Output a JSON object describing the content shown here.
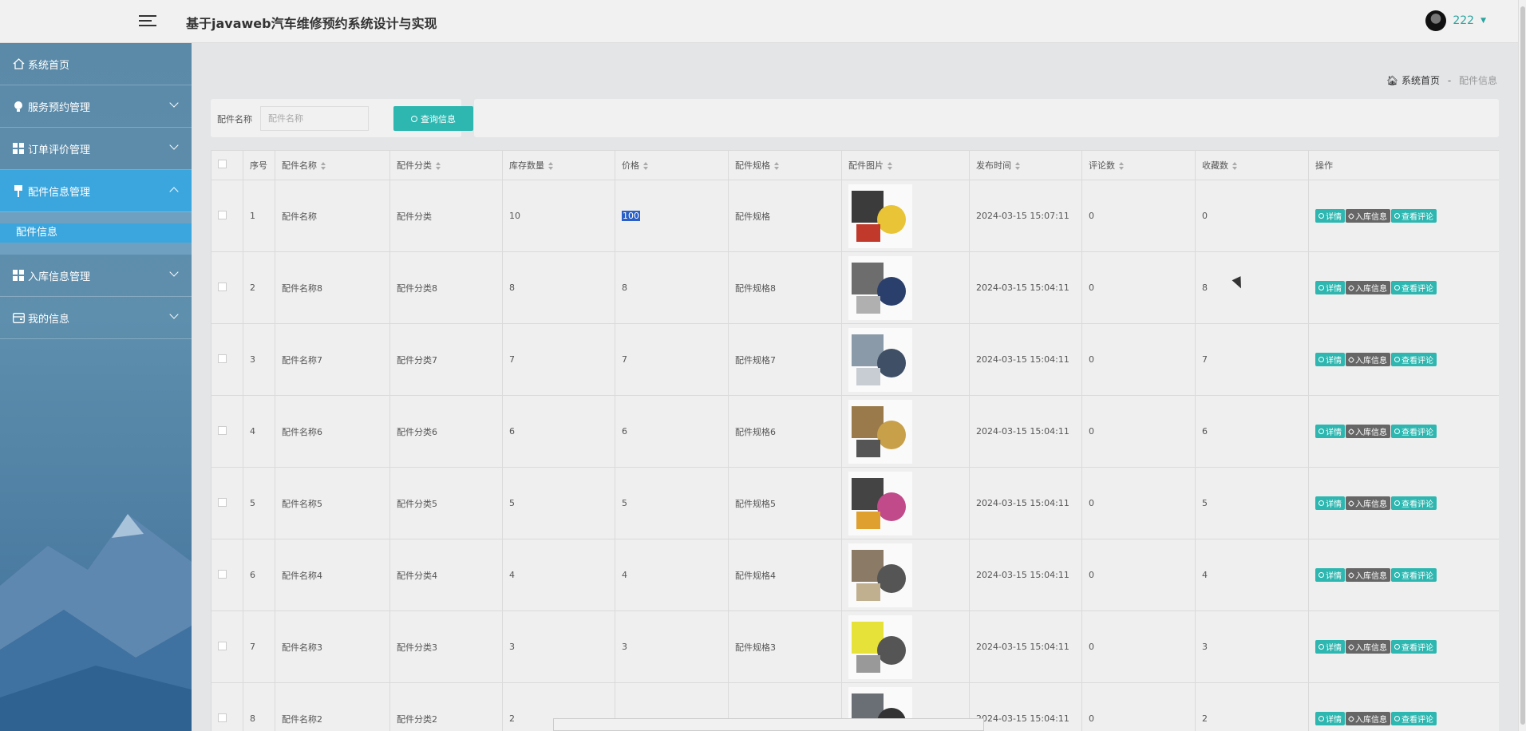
{
  "header": {
    "title": "基于javaweb汽车维修预约系统设计与实现",
    "username": "222"
  },
  "sidebar": {
    "items": [
      {
        "label": "系统首页",
        "icon": "home-icon"
      },
      {
        "label": "服务预约管理",
        "icon": "bulb-icon"
      },
      {
        "label": "订单评价管理",
        "icon": "grid-icon"
      },
      {
        "label": "配件信息管理",
        "icon": "pin-icon"
      },
      {
        "label": "入库信息管理",
        "icon": "grid-icon"
      },
      {
        "label": "我的信息",
        "icon": "card-icon"
      }
    ],
    "submenu_label": "配件信息"
  },
  "breadcrumb": {
    "home": "系统首页",
    "separator": "-",
    "current": "配件信息"
  },
  "search": {
    "label": "配件名称",
    "placeholder": "配件名称",
    "button": "查询信息"
  },
  "table": {
    "columns": [
      "序号",
      "配件名称",
      "配件分类",
      "库存数量",
      "价格",
      "配件规格",
      "配件图片",
      "发布时间",
      "评论数",
      "收藏数",
      "操作"
    ],
    "rows": [
      {
        "idx": "1",
        "name": "配件名称",
        "category": "配件分类",
        "stock": "10",
        "price": "100",
        "spec": "配件规格",
        "time": "2024-03-15 15:07:11",
        "comments": "0",
        "favorites": "0"
      },
      {
        "idx": "2",
        "name": "配件名称8",
        "category": "配件分类8",
        "stock": "8",
        "price": "8",
        "spec": "配件规格8",
        "time": "2024-03-15 15:04:11",
        "comments": "0",
        "favorites": "8"
      },
      {
        "idx": "3",
        "name": "配件名称7",
        "category": "配件分类7",
        "stock": "7",
        "price": "7",
        "spec": "配件规格7",
        "time": "2024-03-15 15:04:11",
        "comments": "0",
        "favorites": "7"
      },
      {
        "idx": "4",
        "name": "配件名称6",
        "category": "配件分类6",
        "stock": "6",
        "price": "6",
        "spec": "配件规格6",
        "time": "2024-03-15 15:04:11",
        "comments": "0",
        "favorites": "6"
      },
      {
        "idx": "5",
        "name": "配件名称5",
        "category": "配件分类5",
        "stock": "5",
        "price": "5",
        "spec": "配件规格5",
        "time": "2024-03-15 15:04:11",
        "comments": "0",
        "favorites": "5"
      },
      {
        "idx": "6",
        "name": "配件名称4",
        "category": "配件分类4",
        "stock": "4",
        "price": "4",
        "spec": "配件规格4",
        "time": "2024-03-15 15:04:11",
        "comments": "0",
        "favorites": "4"
      },
      {
        "idx": "7",
        "name": "配件名称3",
        "category": "配件分类3",
        "stock": "3",
        "price": "3",
        "spec": "配件规格3",
        "time": "2024-03-15 15:04:11",
        "comments": "0",
        "favorites": "3"
      },
      {
        "idx": "8",
        "name": "配件名称2",
        "category": "配件分类2",
        "stock": "2",
        "price": "",
        "spec": "",
        "time": "2024-03-15 15:04:11",
        "comments": "0",
        "favorites": "2"
      }
    ],
    "actions": {
      "detail": "详情",
      "stock_in": "入库信息",
      "view_comments": "查看评论"
    }
  },
  "colors": {
    "accent": "#2db7b0",
    "active_menu": "#3ba6dd",
    "action_gray": "#666666"
  }
}
